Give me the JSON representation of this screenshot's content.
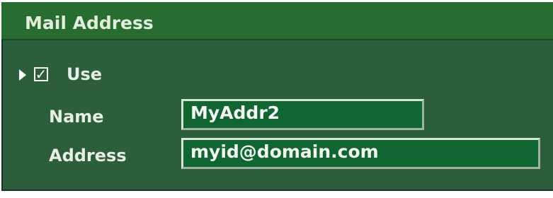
{
  "section": {
    "title": "Mail Address",
    "colors": {
      "header_bg": "#266d2f",
      "body_bg": "#2d5e3b",
      "input_bg": "#0f6630"
    }
  },
  "use_row": {
    "checkbox_checked": true,
    "checkbox_icon": "check-icon",
    "label": "Use"
  },
  "name_row": {
    "label": "Name",
    "value": "MyAddr2"
  },
  "address_row": {
    "label": "Address",
    "value": "myid@domain.com"
  }
}
